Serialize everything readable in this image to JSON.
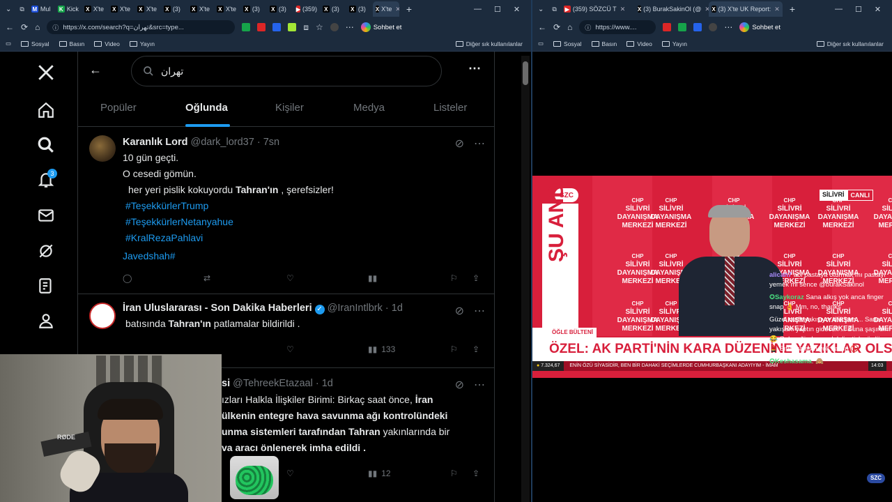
{
  "left_browser": {
    "tabs": [
      {
        "label": "Mul",
        "color": "#1d4ed8",
        "glyph": "M"
      },
      {
        "label": "Kick",
        "color": "#16a34a",
        "glyph": "K"
      },
      {
        "label": "X'te",
        "color": "#000000",
        "glyph": "X"
      },
      {
        "label": "X'te",
        "color": "#000000",
        "glyph": "X"
      },
      {
        "label": "X'te",
        "color": "#000000",
        "glyph": "X"
      },
      {
        "label": "(3)",
        "color": "#000000",
        "glyph": "X"
      },
      {
        "label": "X'te",
        "color": "#000000",
        "glyph": "X"
      },
      {
        "label": "X'te",
        "color": "#000000",
        "glyph": "X"
      },
      {
        "label": "(3)",
        "color": "#000000",
        "glyph": "X"
      },
      {
        "label": "(3)",
        "color": "#000000",
        "glyph": "X"
      },
      {
        "label": "(359)",
        "color": "#dc2626",
        "glyph": "▶"
      },
      {
        "label": "(3)",
        "color": "#000000",
        "glyph": "X"
      },
      {
        "label": "(3)",
        "color": "#000000",
        "glyph": "X"
      },
      {
        "label": "X'te",
        "color": "#000000",
        "glyph": "X"
      }
    ],
    "url": "https://x.com/search?q=تهران&src=type...",
    "chat_button": "Sohbet et",
    "bookmarks": [
      "Sosyal",
      "Basın",
      "Video",
      "Yayın"
    ],
    "bookmarks_right": "Diğer sık kullanılanlar"
  },
  "x_page": {
    "search_query": "تهران",
    "notification_count": "3",
    "tabs": [
      "Popüler",
      "Oğlunda",
      "Kişiler",
      "Medya",
      "Listeler"
    ],
    "active_tab": "Oğlunda",
    "tweets": [
      {
        "name": "Karanlık Lord",
        "handle": "@dark_lord37",
        "time": "7sn",
        "lines": {
          "l1": "10 gün geçti.",
          "l2": "O cesedi gömün.",
          "l3_pre": "her yeri pislik kokuyordu ",
          "l3_bold": "Tahran'ın",
          "l3_post": " , şerefsizler!",
          "h1": "#TeşekkürlerTrump",
          "h2": "#TeşekkürlerNetanyahue",
          "h3": "#KralRezaPahlavi",
          "h4": "Javedshah#"
        }
      },
      {
        "name": "İran Uluslararası - Son Dakika Haberleri",
        "handle": "@IranIntlbrk",
        "time": "1d",
        "line_pre": "batısında ",
        "line_bold": "Tahran'ın",
        "line_post": " patlamalar bildirildi .",
        "views": "133"
      },
      {
        "name_tail": "si",
        "handle": "@TehreekEtazaal",
        "time": "1d",
        "l1_pre": "ızları Halkla İlişkiler Birimi: Birkaç saat önce, ",
        "l1_bold": "İran",
        "l2": "ülkenin entegre hava savunma ağı kontrolündeki",
        "l3_bold": "unma sistemleri tarafından Tahran",
        "l3_post": " yakınlarında bir",
        "l4": "va aracı önlenerek imha edildi .",
        "views": "12"
      }
    ]
  },
  "right_browser": {
    "tabs": [
      {
        "label": "(359) SÖZCÜ T",
        "color": "#dc2626",
        "glyph": "▶"
      },
      {
        "label": "(3) BurakSakinOl (@",
        "color": "#000000",
        "glyph": "X"
      },
      {
        "label": "(3) X'te UK Report:",
        "color": "#000000",
        "glyph": "X"
      }
    ],
    "url": "https://www....",
    "chat_button": "Sohbet et",
    "bookmarks": [
      "Sosyal",
      "Basın",
      "Video",
      "Yayın"
    ],
    "bookmarks_right": "Diğer sık kullanılanlar"
  },
  "stream": {
    "channel_logo": "SZC",
    "location": "SİLİVRİ",
    "live": "CANLI",
    "vertical": "ŞU ANDA",
    "backdrop_line1": "SİLİVRİ",
    "backdrop_line2": "DAYANIŞMA",
    "backdrop_line3": "MERKEZİ",
    "backdrop_logo": "CHP",
    "program": "ÖĞLE BÜLTENİ",
    "headline": "ÖZEL: AK PARTİ'NİN KARA DÜZENİNE YAZIKLAR OLSUN",
    "ticker_value": "7.324,67",
    "ticker_text": "ENİN ÖZÜ SİYASİDİR, BEN BİR DAHAKİ SEÇİMLERDE CUMHURBAŞKANI ADAYIYIM - İMAM",
    "ticker_time": "14:03",
    "corner_logo": "SZC"
  },
  "chat": [
    {
      "name": "alican7",
      "text": " abi pastaya oturmak mı pastayı yemek mi sence @burakSakinol",
      "color": "#a78bfa"
    },
    {
      "name": "Saykoraz",
      "text": " Sana alkış yok anca finger snap 👌 Mm, no, thanks",
      "color": "#4ade80"
    },
    {
      "name": "",
      "text": "Güzel outfit yakışıyor dük'lam ... Sana yakışanı yaptın gidecek ... Buna şaşırdım 😂 Geleceğinden parlak lipstick sürdüm 💄 Sıfır gramsın yok kalsın 🚫",
      "color": "#ffffff"
    },
    {
      "name": "Keshasama",
      "text": ": 🙈",
      "color": "#4ade80"
    }
  ]
}
